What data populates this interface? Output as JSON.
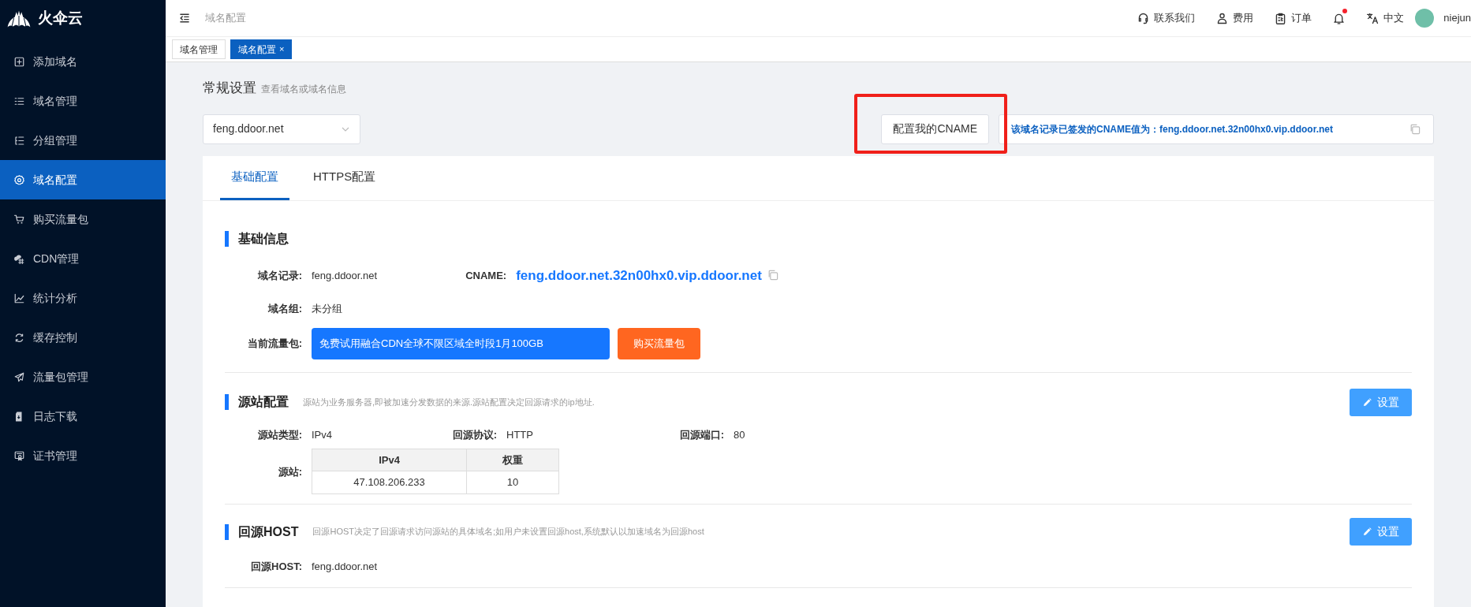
{
  "sidebar": {
    "brand": "火伞云",
    "items": [
      {
        "label": "添加域名",
        "selected": false
      },
      {
        "label": "域名管理",
        "selected": false
      },
      {
        "label": "分组管理",
        "selected": false
      },
      {
        "label": "域名配置",
        "selected": true
      },
      {
        "label": "购买流量包",
        "selected": false
      },
      {
        "label": "CDN管理",
        "selected": false
      },
      {
        "label": "统计分析",
        "selected": false
      },
      {
        "label": "缓存控制",
        "selected": false
      },
      {
        "label": "流量包管理",
        "selected": false
      },
      {
        "label": "日志下载",
        "selected": false
      },
      {
        "label": "证书管理",
        "selected": false
      }
    ]
  },
  "topbar": {
    "breadcrumb": "域名配置",
    "actions": [
      {
        "label": "联系我们"
      },
      {
        "label": "费用"
      },
      {
        "label": "订单"
      },
      {
        "badge": true
      },
      {
        "label": "中文"
      }
    ],
    "user": "niejun"
  },
  "page_tabs": [
    {
      "label": "域名管理",
      "selected": false,
      "closable": false
    },
    {
      "label": "域名配置",
      "selected": true,
      "closable": true,
      "close": "×"
    }
  ],
  "header": {
    "title": "常规设置",
    "subtitle": "查看域名或域名信息",
    "domain_select": "feng.ddoor.net",
    "cname_button": "配置我的CNAME",
    "annotation_box": true,
    "cname_notice": "该域名记录已签发的CNAME值为：feng.ddoor.net.32n00hx0.vip.ddoor.net"
  },
  "config_tabs": [
    {
      "label": "基础配置",
      "selected": true
    },
    {
      "label": "HTTPS配置",
      "selected": false
    }
  ],
  "basic_info": {
    "title": "基础信息",
    "domain_label": "域名记录:",
    "domain": "feng.ddoor.net",
    "cname_label": "CNAME:",
    "cname": "feng.ddoor.net.32n00hx0.vip.ddoor.net",
    "group_label": "域名组:",
    "group": "未分组",
    "package_label": "当前流量包:",
    "package": "免费试用融合CDN全球不限区域全时段1月100GB",
    "buy_button": "购买流量包"
  },
  "origin": {
    "title": "源站配置",
    "description": "源站为业务服务器,即被加速分发数据的来源.源站配置决定回源请求的ip地址.",
    "edit_button": "设置",
    "fields": [
      {
        "label": "源站类型:",
        "value": "IPv4"
      },
      {
        "label": "回源协议:",
        "value": "HTTP"
      },
      {
        "label": "回源端口:",
        "value": "80"
      }
    ],
    "table_label": "源站:",
    "table": {
      "columns": [
        "IPv4",
        "权重"
      ],
      "rows": [
        [
          "47.108.206.233",
          "10"
        ]
      ]
    }
  },
  "origin_host": {
    "title": "回源HOST",
    "description": "回源HOST决定了回源请求访问源站的具体域名;如用户未设置回源host,系统默认以加速域名为回源host",
    "edit_button": "设置",
    "label": "回源HOST:",
    "value": "feng.ddoor.net"
  }
}
